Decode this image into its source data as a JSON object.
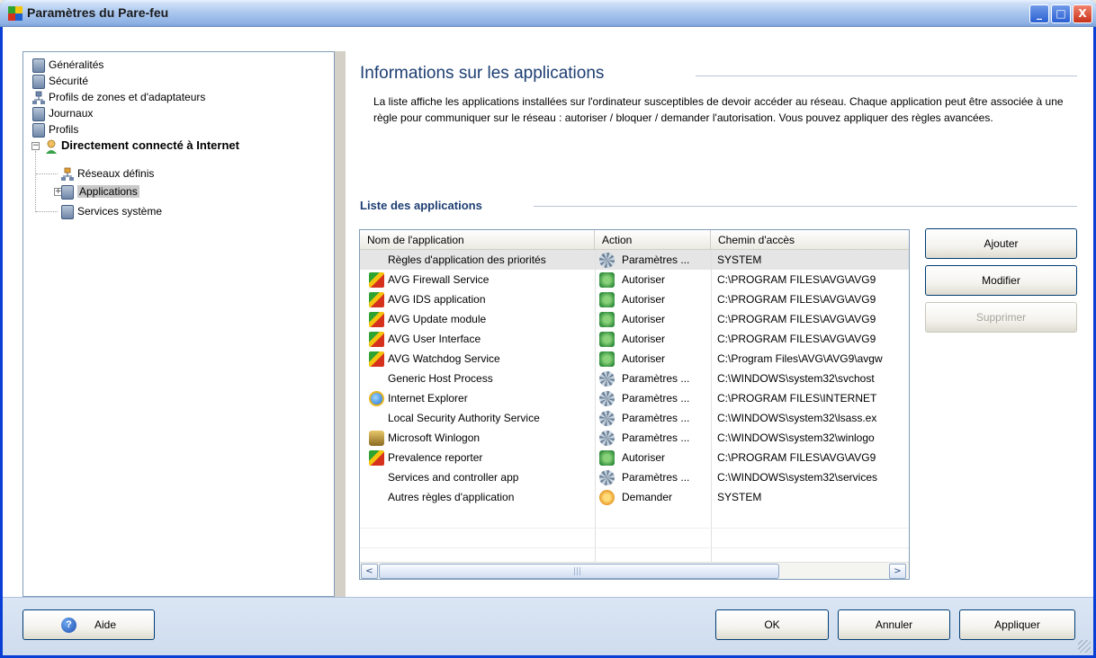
{
  "window": {
    "title": "Paramètres du Pare-feu",
    "minimize": "_",
    "maximize": "□",
    "close": "X"
  },
  "tree": {
    "items": [
      {
        "label": "Généralités",
        "icon": "document-icon"
      },
      {
        "label": "Sécurité",
        "icon": "document-icon"
      },
      {
        "label": "Profils de zones et d'adaptateurs",
        "icon": "network-icon"
      },
      {
        "label": "Journaux",
        "icon": "document-icon"
      },
      {
        "label": "Profils",
        "icon": "document-icon"
      },
      {
        "label": "Directement connecté à Internet",
        "icon": "user-icon",
        "bold": true,
        "expanded": true
      },
      {
        "label": "Réseaux définis",
        "icon": "network-icon"
      },
      {
        "label": "Applications",
        "icon": "document-icon",
        "selected": true
      },
      {
        "label": "Services système",
        "icon": "document-icon"
      }
    ],
    "expand_minus": "−",
    "expand_plus": "+"
  },
  "content": {
    "title": "Informations sur les applications",
    "description": "La liste affiche les applications installées sur l'ordinateur susceptibles de devoir accéder au réseau. Chaque application peut être associée à une règle pour communiquer sur le réseau : autoriser / bloquer / demander l'autorisation. Vous pouvez appliquer des règles avancées.",
    "list_title": "Liste des applications"
  },
  "table": {
    "columns": [
      "Nom de l'application",
      "Action",
      "Chemin d'accès"
    ],
    "rows": [
      {
        "name": "Règles d'application des priorités",
        "icon": "none",
        "action": "Paramètres ...",
        "action_icon": "gear",
        "path": "SYSTEM"
      },
      {
        "name": "AVG Firewall Service",
        "icon": "avg",
        "action": "Autoriser",
        "action_icon": "allow",
        "path": "C:\\PROGRAM FILES\\AVG\\AVG9"
      },
      {
        "name": "AVG IDS application",
        "icon": "avg",
        "action": "Autoriser",
        "action_icon": "allow",
        "path": "C:\\PROGRAM FILES\\AVG\\AVG9"
      },
      {
        "name": "AVG Update module",
        "icon": "avg",
        "action": "Autoriser",
        "action_icon": "allow",
        "path": "C:\\PROGRAM FILES\\AVG\\AVG9"
      },
      {
        "name": "AVG User Interface",
        "icon": "avg",
        "action": "Autoriser",
        "action_icon": "allow",
        "path": "C:\\PROGRAM FILES\\AVG\\AVG9"
      },
      {
        "name": "AVG Watchdog Service",
        "icon": "avg",
        "action": "Autoriser",
        "action_icon": "allow",
        "path": "C:\\Program Files\\AVG\\AVG9\\avgw"
      },
      {
        "name": "Generic Host Process",
        "icon": "none",
        "action": "Paramètres ...",
        "action_icon": "gear",
        "path": "C:\\WINDOWS\\system32\\svchost"
      },
      {
        "name": "Internet Explorer",
        "icon": "ie",
        "action": "Paramètres ...",
        "action_icon": "gear",
        "path": "C:\\PROGRAM FILES\\INTERNET"
      },
      {
        "name": "Local Security Authority Service",
        "icon": "none",
        "action": "Paramètres ...",
        "action_icon": "gear",
        "path": "C:\\WINDOWS\\system32\\lsass.ex"
      },
      {
        "name": "Microsoft Winlogon",
        "icon": "winlogon",
        "action": "Paramètres ...",
        "action_icon": "gear",
        "path": "C:\\WINDOWS\\system32\\winlogo"
      },
      {
        "name": "Prevalence reporter",
        "icon": "avg",
        "action": "Autoriser",
        "action_icon": "allow",
        "path": "C:\\PROGRAM FILES\\AVG\\AVG9"
      },
      {
        "name": "Services and controller app",
        "icon": "none",
        "action": "Paramètres ...",
        "action_icon": "gear",
        "path": "C:\\WINDOWS\\system32\\services"
      },
      {
        "name": "Autres règles d'application",
        "icon": "none",
        "action": "Demander",
        "action_icon": "ask",
        "path": "SYSTEM"
      }
    ],
    "scroll_left": "<",
    "scroll_right": ">",
    "scroll_grip": "|||"
  },
  "side_buttons": {
    "add": "Ajouter",
    "edit": "Modifier",
    "delete": "Supprimer"
  },
  "footer": {
    "help": "Aide",
    "help_icon_glyph": "?",
    "ok": "OK",
    "cancel": "Annuler",
    "apply": "Appliquer"
  }
}
